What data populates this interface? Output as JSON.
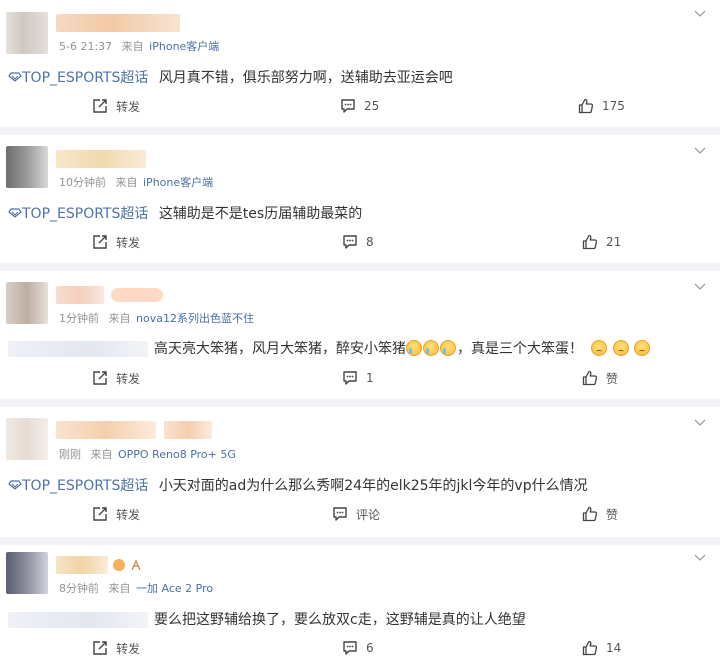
{
  "posts": [
    {
      "time": "5-6 21:37",
      "source_prefix": "来自",
      "device": "iPhone客户端",
      "topic": "TOP_ESPORTS超话",
      "text": "风月真不错，俱乐部努力啊，送辅助去亚运会吧",
      "share_label": "转发",
      "comment_label": "25",
      "like_label": "175"
    },
    {
      "time": "10分钟前",
      "source_prefix": "来自",
      "device": "iPhone客户端",
      "topic": "TOP_ESPORTS超话",
      "text": "这辅助是不是tes历届辅助最菜的",
      "share_label": "转发",
      "comment_label": "8",
      "like_label": "21"
    },
    {
      "time": "1分钟前",
      "source_prefix": "来自",
      "device": "nova12系列出色蓝不住",
      "text": "高天亮大笨猪，风月大笨猪，醉安小笨猪",
      "text2": "，真是三个大笨蛋！",
      "share_label": "转发",
      "comment_label": "1",
      "like_label": "赞"
    },
    {
      "time": "刚刚",
      "source_prefix": "来自",
      "device": "OPPO Reno8 Pro+ 5G",
      "topic": "TOP_ESPORTS超话",
      "text": "小天对面的ad为什么那么秀啊24年的elk25年的jkl今年的vp什么情况",
      "share_label": "转发",
      "comment_label": "评论",
      "like_label": "赞"
    },
    {
      "time": "8分钟前",
      "source_prefix": "来自",
      "device": "一加 Ace 2 Pro",
      "text": "要么把这野辅给换了，要么放双c走，这野辅是真的让人绝望",
      "share_label": "转发",
      "comment_label": "6",
      "like_label": "14"
    }
  ],
  "icons": {
    "share": "share-icon",
    "comment": "comment-icon",
    "like": "thumbs-up-icon",
    "more": "chevron-down-icon",
    "topic": "diamond-icon"
  },
  "colors": {
    "topic": "#4d73a8",
    "meta": "#939393",
    "device": "#4a6fa8",
    "separator": "#f1f2f5"
  }
}
